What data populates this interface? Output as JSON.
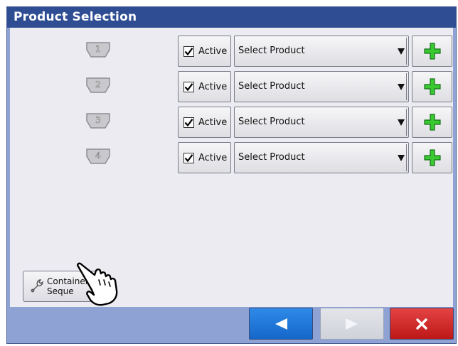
{
  "window": {
    "title": "Product Selection"
  },
  "rows": [
    {
      "number": "1",
      "active_label": "Active",
      "active_checked": true,
      "product_value": "Select Product"
    },
    {
      "number": "2",
      "active_label": "Active",
      "active_checked": true,
      "product_value": "Select Product"
    },
    {
      "number": "3",
      "active_label": "Active",
      "active_checked": true,
      "product_value": "Select Product"
    },
    {
      "number": "4",
      "active_label": "Active",
      "active_checked": true,
      "product_value": "Select Product"
    }
  ],
  "container_button": {
    "label": "Container\nSeque"
  },
  "icons": {
    "add": "plus-icon",
    "container": "wrench-icon",
    "back": "left-arrow-icon",
    "next": "right-arrow-icon",
    "cancel": "close-icon",
    "pointer": "pointing-hand-icon",
    "row_badge": "product-bin-badge-icon"
  },
  "colors": {
    "title_bar": "#2f4d93",
    "back_button": "#1f74d6",
    "cancel_button": "#cf2020",
    "add_icon": "#35c12c"
  }
}
